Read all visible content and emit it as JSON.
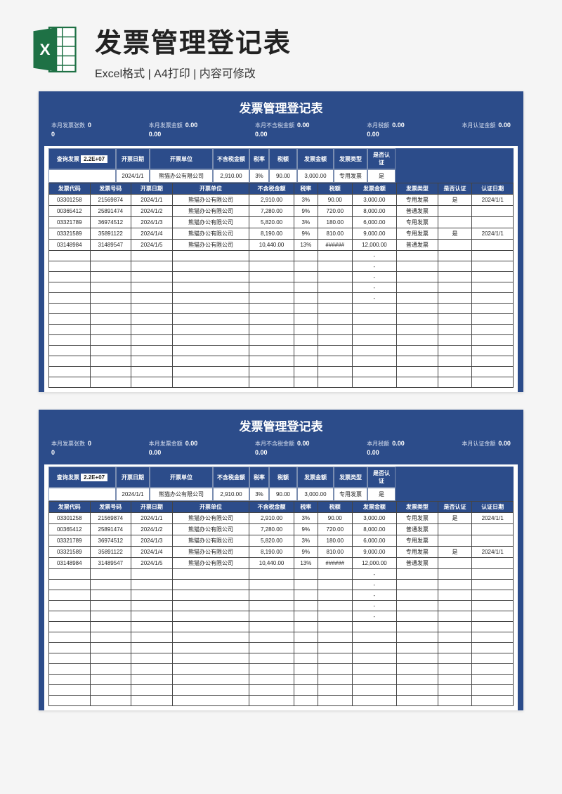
{
  "header": {
    "title": "发票管理登记表",
    "subtitle": "Excel格式 | A4打印 | 内容可修改"
  },
  "card": {
    "title": "发票管理登记表",
    "stats": [
      {
        "l1": "本月发票张数",
        "v1": "0",
        "l2": "",
        "v2": "0"
      },
      {
        "l1": "本月发票金额",
        "v1": "0.00",
        "l2": "",
        "v2": "0.00"
      },
      {
        "l1": "本月不含税金额",
        "v1": "0.00",
        "l2": "",
        "v2": "0.00"
      },
      {
        "l1": "本月税额",
        "v1": "0.00",
        "l2": "",
        "v2": "0.00"
      },
      {
        "l1": "本月认证金额",
        "v1": "0.00",
        "l2": "",
        "v2": ""
      }
    ]
  },
  "search": {
    "label": "查询发票",
    "value": "2.2E+07",
    "heads": [
      "开票日期",
      "开票单位",
      "不含税金额",
      "税率",
      "税额",
      "发票金额",
      "发票类型",
      "是否认证"
    ],
    "row": [
      "2024/1/1",
      "熊猫办公有限公司",
      "2,910.00",
      "3%",
      "90.00",
      "3,000.00",
      "专用发票",
      "是"
    ]
  },
  "table": {
    "heads": [
      "发票代码",
      "发票号码",
      "开票日期",
      "开票单位",
      "不含税金额",
      "税率",
      "税额",
      "发票金额",
      "发票类型",
      "是否认证",
      "认证日期"
    ],
    "rows": [
      [
        "03301258",
        "21569874",
        "2024/1/1",
        "熊猫办公有限公司",
        "2,910.00",
        "3%",
        "90.00",
        "3,000.00",
        "专用发票",
        "是",
        "2024/1/1"
      ],
      [
        "00365412",
        "25891474",
        "2024/1/2",
        "熊猫办公有限公司",
        "7,280.00",
        "9%",
        "720.00",
        "8,000.00",
        "普通发票",
        "",
        ""
      ],
      [
        "03321789",
        "36974512",
        "2024/1/3",
        "熊猫办公有限公司",
        "5,820.00",
        "3%",
        "180.00",
        "6,000.00",
        "专用发票",
        "",
        ""
      ],
      [
        "03321589",
        "35891122",
        "2024/1/4",
        "熊猫办公有限公司",
        "8,190.00",
        "9%",
        "810.00",
        "9,000.00",
        "专用发票",
        "是",
        "2024/1/1"
      ],
      [
        "03148984",
        "31489547",
        "2024/1/5",
        "熊猫办公有限公司",
        "10,440.00",
        "13%",
        "######",
        "12,000.00",
        "普通发票",
        "",
        ""
      ]
    ],
    "emptyRows": 13,
    "dashCol": 7
  },
  "chart_data": {
    "type": "table",
    "title": "发票管理登记表",
    "columns": [
      "发票代码",
      "发票号码",
      "开票日期",
      "开票单位",
      "不含税金额",
      "税率",
      "税额",
      "发票金额",
      "发票类型",
      "是否认证",
      "认证日期"
    ],
    "records": [
      {
        "发票代码": "03301258",
        "发票号码": "21569874",
        "开票日期": "2024/1/1",
        "开票单位": "熊猫办公有限公司",
        "不含税金额": 2910.0,
        "税率": "3%",
        "税额": 90.0,
        "发票金额": 3000.0,
        "发票类型": "专用发票",
        "是否认证": "是",
        "认证日期": "2024/1/1"
      },
      {
        "发票代码": "00365412",
        "发票号码": "25891474",
        "开票日期": "2024/1/2",
        "开票单位": "熊猫办公有限公司",
        "不含税金额": 7280.0,
        "税率": "9%",
        "税额": 720.0,
        "发票金额": 8000.0,
        "发票类型": "普通发票",
        "是否认证": "",
        "认证日期": ""
      },
      {
        "发票代码": "03321789",
        "发票号码": "36974512",
        "开票日期": "2024/1/3",
        "开票单位": "熊猫办公有限公司",
        "不含税金额": 5820.0,
        "税率": "3%",
        "税额": 180.0,
        "发票金额": 6000.0,
        "发票类型": "专用发票",
        "是否认证": "",
        "认证日期": ""
      },
      {
        "发票代码": "03321589",
        "发票号码": "35891122",
        "开票日期": "2024/1/4",
        "开票单位": "熊猫办公有限公司",
        "不含税金额": 8190.0,
        "税率": "9%",
        "税额": 810.0,
        "发票金额": 9000.0,
        "发票类型": "专用发票",
        "是否认证": "是",
        "认证日期": "2024/1/1"
      },
      {
        "发票代码": "03148984",
        "发票号码": "31489547",
        "开票日期": "2024/1/5",
        "开票单位": "熊猫办公有限公司",
        "不含税金额": 10440.0,
        "税率": "13%",
        "税额": null,
        "发票金额": 12000.0,
        "发票类型": "普通发票",
        "是否认证": "",
        "认证日期": ""
      }
    ]
  }
}
